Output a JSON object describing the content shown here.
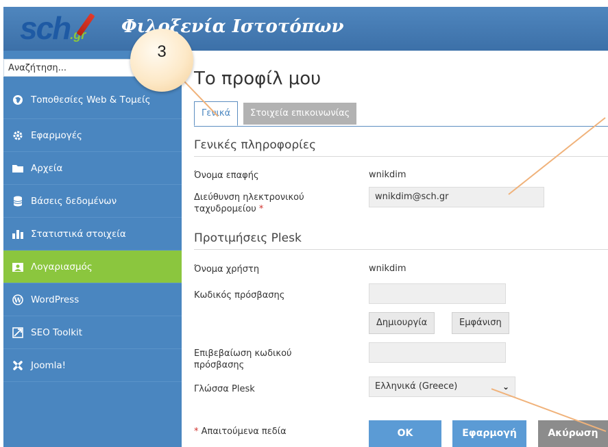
{
  "header": {
    "logo_main": "sch",
    "logo_sub": ".gr",
    "title": "Φιλοξενία Ιστοτόπων"
  },
  "sidebar": {
    "search_placeholder": "Αναζήτηση...",
    "items": [
      {
        "label": "Τοποθεσίες Web & Τομείς",
        "icon": "globe-icon",
        "active": false
      },
      {
        "label": "Εφαρμογές",
        "icon": "gear-icon",
        "active": false
      },
      {
        "label": "Αρχεία",
        "icon": "folder-icon",
        "active": false
      },
      {
        "label": "Βάσεις δεδομένων",
        "icon": "database-icon",
        "active": false
      },
      {
        "label": "Στατιστικά στοιχεία",
        "icon": "bar-chart-icon",
        "active": false
      },
      {
        "label": "Λογαριασμός",
        "icon": "account-icon",
        "active": true
      },
      {
        "label": "WordPress",
        "icon": "wordpress-icon",
        "active": false
      },
      {
        "label": "SEO Toolkit",
        "icon": "seo-icon",
        "active": false
      },
      {
        "label": "Joomla!",
        "icon": "joomla-icon",
        "active": false
      }
    ]
  },
  "main": {
    "page_title": "Το προφίλ μου",
    "tabs": [
      {
        "label": "Γενικά",
        "active": true
      },
      {
        "label": "Στοιχεία επικοινωνίας",
        "active": false
      }
    ],
    "general_section": "Γενικές πληροφορίες",
    "contact_name_label": "Όνομα επαφής",
    "contact_name_value": "wnikdim",
    "email_label": "Διεύθυνση ηλεκτρονικού ταχυδρομείου",
    "email_value": "wnikdim@sch.gr",
    "plesk_section": "Προτιμήσεις Plesk",
    "username_label": "Όνομα χρήστη",
    "username_value": "wnikdim",
    "password_label": "Κωδικός πρόσβασης",
    "generate_button": "Δημιουργία",
    "show_button": "Εμφάνιση",
    "confirm_label": "Επιβεβαίωση κωδικού πρόσβασης",
    "language_label": "Γλώσσα Plesk",
    "language_value": "Ελληνικά (Greece)",
    "required_star": "*",
    "required_note": "Απαιτούμενα πεδία",
    "ok_button": "OK",
    "apply_button": "Εφαρμογή",
    "cancel_button": "Ακύρωση"
  },
  "callout": {
    "number": "3"
  },
  "colors": {
    "header": "#3c70a8",
    "sidebar": "#4a86c0",
    "active_item": "#8bc63e",
    "primary_button": "#5b9bd5",
    "cancel_button": "#8c8c8c",
    "arrow": "#f0b27a"
  }
}
